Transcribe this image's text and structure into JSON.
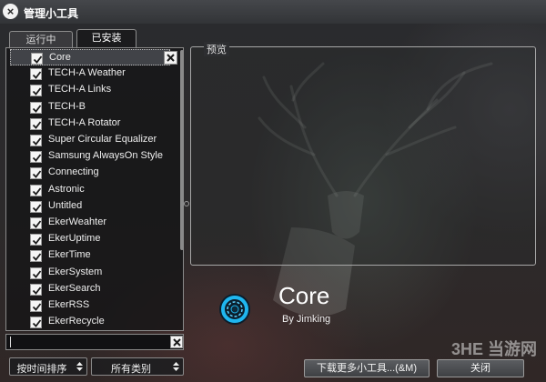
{
  "window": {
    "title": "管理小工具"
  },
  "tabs": [
    {
      "label": "运行中",
      "active": false
    },
    {
      "label": "已安装",
      "active": true
    }
  ],
  "gadgets": [
    {
      "label": "Core",
      "checked": true,
      "selected": true
    },
    {
      "label": "TECH-A Weather",
      "checked": true
    },
    {
      "label": "TECH-A Links",
      "checked": true
    },
    {
      "label": "TECH-B",
      "checked": true
    },
    {
      "label": "TECH-A Rotator",
      "checked": true
    },
    {
      "label": "Super Circular Equalizer",
      "checked": true
    },
    {
      "label": "Samsung AlwaysOn Style",
      "checked": true
    },
    {
      "label": "Connecting",
      "checked": true
    },
    {
      "label": "Astronic",
      "checked": true
    },
    {
      "label": "Untitled",
      "checked": true
    },
    {
      "label": "EkerWeahter",
      "checked": true
    },
    {
      "label": "EkerUptime",
      "checked": true
    },
    {
      "label": "EkerTime",
      "checked": true
    },
    {
      "label": "EkerSystem",
      "checked": true
    },
    {
      "label": "EkerSearch",
      "checked": true
    },
    {
      "label": "EkerRSS",
      "checked": true
    },
    {
      "label": "EkerRecycle",
      "checked": true
    }
  ],
  "search": {
    "value": ""
  },
  "filters": {
    "sort_label": "按时间排序",
    "category_label": "所有类别"
  },
  "preview": {
    "label": "预览",
    "gadget_name": "Core",
    "gadget_author": "By Jimking"
  },
  "buttons": {
    "more_label": "下载更多小工具...(&M)",
    "close_label": "关闭"
  },
  "watermark": "3HE 当游网",
  "colors": {
    "accent_ring": "#19b8f0",
    "panel_border": "#a7a7a7"
  },
  "icons": [
    "close-icon",
    "checkbox-checked-icon",
    "remove-icon",
    "clear-icon",
    "sort-arrows-icon",
    "core-gadget-icon"
  ]
}
